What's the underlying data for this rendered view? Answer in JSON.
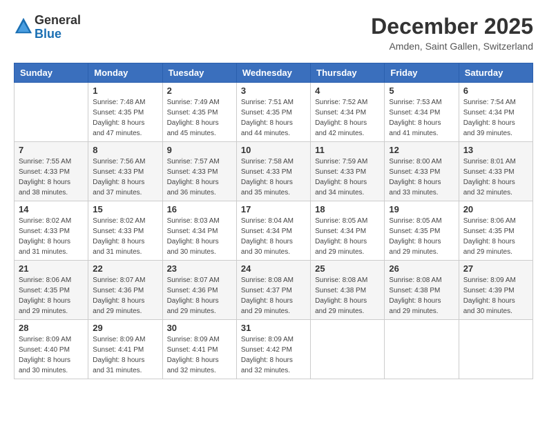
{
  "header": {
    "logo_line1": "General",
    "logo_line2": "Blue",
    "month": "December 2025",
    "location": "Amden, Saint Gallen, Switzerland"
  },
  "weekdays": [
    "Sunday",
    "Monday",
    "Tuesday",
    "Wednesday",
    "Thursday",
    "Friday",
    "Saturday"
  ],
  "weeks": [
    [
      {
        "day": "",
        "info": ""
      },
      {
        "day": "1",
        "info": "Sunrise: 7:48 AM\nSunset: 4:35 PM\nDaylight: 8 hours\nand 47 minutes."
      },
      {
        "day": "2",
        "info": "Sunrise: 7:49 AM\nSunset: 4:35 PM\nDaylight: 8 hours\nand 45 minutes."
      },
      {
        "day": "3",
        "info": "Sunrise: 7:51 AM\nSunset: 4:35 PM\nDaylight: 8 hours\nand 44 minutes."
      },
      {
        "day": "4",
        "info": "Sunrise: 7:52 AM\nSunset: 4:34 PM\nDaylight: 8 hours\nand 42 minutes."
      },
      {
        "day": "5",
        "info": "Sunrise: 7:53 AM\nSunset: 4:34 PM\nDaylight: 8 hours\nand 41 minutes."
      },
      {
        "day": "6",
        "info": "Sunrise: 7:54 AM\nSunset: 4:34 PM\nDaylight: 8 hours\nand 39 minutes."
      }
    ],
    [
      {
        "day": "7",
        "info": "Sunrise: 7:55 AM\nSunset: 4:33 PM\nDaylight: 8 hours\nand 38 minutes."
      },
      {
        "day": "8",
        "info": "Sunrise: 7:56 AM\nSunset: 4:33 PM\nDaylight: 8 hours\nand 37 minutes."
      },
      {
        "day": "9",
        "info": "Sunrise: 7:57 AM\nSunset: 4:33 PM\nDaylight: 8 hours\nand 36 minutes."
      },
      {
        "day": "10",
        "info": "Sunrise: 7:58 AM\nSunset: 4:33 PM\nDaylight: 8 hours\nand 35 minutes."
      },
      {
        "day": "11",
        "info": "Sunrise: 7:59 AM\nSunset: 4:33 PM\nDaylight: 8 hours\nand 34 minutes."
      },
      {
        "day": "12",
        "info": "Sunrise: 8:00 AM\nSunset: 4:33 PM\nDaylight: 8 hours\nand 33 minutes."
      },
      {
        "day": "13",
        "info": "Sunrise: 8:01 AM\nSunset: 4:33 PM\nDaylight: 8 hours\nand 32 minutes."
      }
    ],
    [
      {
        "day": "14",
        "info": "Sunrise: 8:02 AM\nSunset: 4:33 PM\nDaylight: 8 hours\nand 31 minutes."
      },
      {
        "day": "15",
        "info": "Sunrise: 8:02 AM\nSunset: 4:33 PM\nDaylight: 8 hours\nand 31 minutes."
      },
      {
        "day": "16",
        "info": "Sunrise: 8:03 AM\nSunset: 4:34 PM\nDaylight: 8 hours\nand 30 minutes."
      },
      {
        "day": "17",
        "info": "Sunrise: 8:04 AM\nSunset: 4:34 PM\nDaylight: 8 hours\nand 30 minutes."
      },
      {
        "day": "18",
        "info": "Sunrise: 8:05 AM\nSunset: 4:34 PM\nDaylight: 8 hours\nand 29 minutes."
      },
      {
        "day": "19",
        "info": "Sunrise: 8:05 AM\nSunset: 4:35 PM\nDaylight: 8 hours\nand 29 minutes."
      },
      {
        "day": "20",
        "info": "Sunrise: 8:06 AM\nSunset: 4:35 PM\nDaylight: 8 hours\nand 29 minutes."
      }
    ],
    [
      {
        "day": "21",
        "info": "Sunrise: 8:06 AM\nSunset: 4:35 PM\nDaylight: 8 hours\nand 29 minutes."
      },
      {
        "day": "22",
        "info": "Sunrise: 8:07 AM\nSunset: 4:36 PM\nDaylight: 8 hours\nand 29 minutes."
      },
      {
        "day": "23",
        "info": "Sunrise: 8:07 AM\nSunset: 4:36 PM\nDaylight: 8 hours\nand 29 minutes."
      },
      {
        "day": "24",
        "info": "Sunrise: 8:08 AM\nSunset: 4:37 PM\nDaylight: 8 hours\nand 29 minutes."
      },
      {
        "day": "25",
        "info": "Sunrise: 8:08 AM\nSunset: 4:38 PM\nDaylight: 8 hours\nand 29 minutes."
      },
      {
        "day": "26",
        "info": "Sunrise: 8:08 AM\nSunset: 4:38 PM\nDaylight: 8 hours\nand 29 minutes."
      },
      {
        "day": "27",
        "info": "Sunrise: 8:09 AM\nSunset: 4:39 PM\nDaylight: 8 hours\nand 30 minutes."
      }
    ],
    [
      {
        "day": "28",
        "info": "Sunrise: 8:09 AM\nSunset: 4:40 PM\nDaylight: 8 hours\nand 30 minutes."
      },
      {
        "day": "29",
        "info": "Sunrise: 8:09 AM\nSunset: 4:41 PM\nDaylight: 8 hours\nand 31 minutes."
      },
      {
        "day": "30",
        "info": "Sunrise: 8:09 AM\nSunset: 4:41 PM\nDaylight: 8 hours\nand 32 minutes."
      },
      {
        "day": "31",
        "info": "Sunrise: 8:09 AM\nSunset: 4:42 PM\nDaylight: 8 hours\nand 32 minutes."
      },
      {
        "day": "",
        "info": ""
      },
      {
        "day": "",
        "info": ""
      },
      {
        "day": "",
        "info": ""
      }
    ]
  ]
}
